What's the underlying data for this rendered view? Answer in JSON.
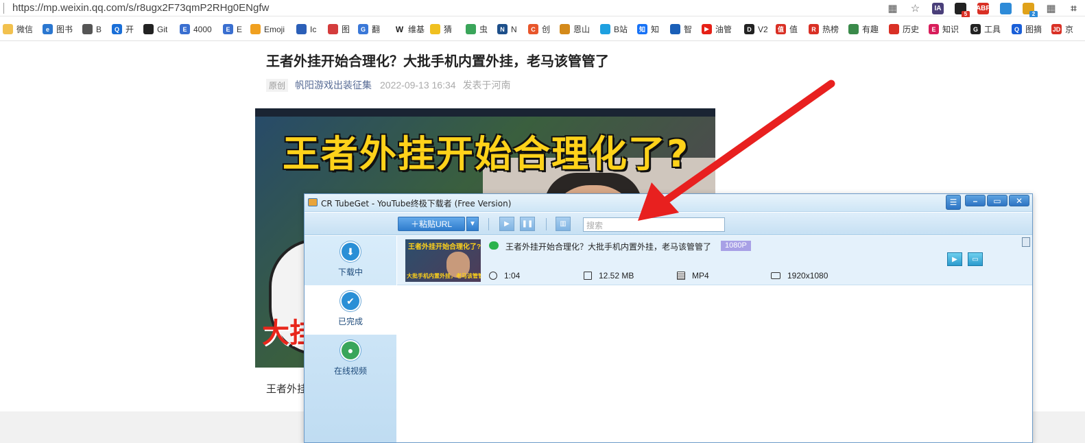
{
  "browser": {
    "url": "https://mp.weixin.qq.com/s/r8ugx2F73qmP2RHg0ENgfw",
    "extensions": [
      {
        "icon": "qr-code-icon",
        "text": "▦",
        "color": "#555555"
      },
      {
        "icon": "star-icon",
        "text": "☆",
        "color": "#555555"
      },
      {
        "icon": "ia-extension-icon",
        "text": "IA",
        "color": "#4a3f7a"
      },
      {
        "icon": "extension-red-icon",
        "text": "",
        "badge": "5",
        "color": "#222222",
        "badge_color": "#d93025"
      },
      {
        "icon": "abp-icon",
        "text": "ABP",
        "color": "#d93025"
      },
      {
        "icon": "color-wheel-icon",
        "text": "",
        "color": "#2e8bd8"
      },
      {
        "icon": "translate-icon",
        "text": "",
        "badge": "2",
        "color": "#e0a21a",
        "badge_color": "#2e8bd8"
      },
      {
        "icon": "grid-icon",
        "text": "▦",
        "color": "#555555"
      },
      {
        "icon": "crop-icon",
        "text": "⌗",
        "color": "#555555"
      }
    ]
  },
  "bookmarks": [
    {
      "label": "微信",
      "icon": "folder-icon",
      "color": "#f2c14e",
      "glyph": ""
    },
    {
      "label": "图书",
      "icon": "ie-icon",
      "color": "#2b77d0",
      "glyph": "e"
    },
    {
      "label": "B",
      "icon": "globe-icon",
      "color": "#555555",
      "glyph": ""
    },
    {
      "label": "开",
      "icon": "qcloud-icon",
      "color": "#1a6fd8",
      "glyph": "Q"
    },
    {
      "label": "Git",
      "icon": "github-icon",
      "color": "#222222",
      "glyph": ""
    },
    {
      "label": "4000",
      "icon": "e-icon",
      "color": "#3a6fd0",
      "glyph": "E"
    },
    {
      "label": "E",
      "icon": "e-icon",
      "color": "#3a6fd0",
      "glyph": "E"
    },
    {
      "label": "Emoji",
      "icon": "emoji-icon",
      "color": "#f0a020",
      "glyph": ""
    },
    {
      "label": "Ic",
      "icon": "flag-icon",
      "color": "#2b5fb8",
      "glyph": ""
    },
    {
      "label": "图",
      "icon": "grid-red-icon",
      "color": "#d43c3c",
      "glyph": ""
    },
    {
      "label": "翻",
      "icon": "translate-icon",
      "color": "#3a78d8",
      "glyph": "G"
    },
    {
      "label": "维基",
      "icon": "wikipedia-icon",
      "color": "#ffffff",
      "glyph": "W"
    },
    {
      "label": "猜",
      "icon": "cloud-icon",
      "color": "#f0c020",
      "glyph": ""
    },
    {
      "label": "虫",
      "icon": "bug-icon",
      "color": "#3aa55a",
      "glyph": ""
    },
    {
      "label": "N",
      "icon": "n-icon",
      "color": "#1d4f8a",
      "glyph": "N"
    },
    {
      "label": "创",
      "icon": "c-icon",
      "color": "#e8562b",
      "glyph": "C"
    },
    {
      "label": "恩山",
      "icon": "router-icon",
      "color": "#d48a1a",
      "glyph": ""
    },
    {
      "label": "B站",
      "icon": "bilibili-icon",
      "color": "#1ea0e0",
      "glyph": ""
    },
    {
      "label": "知",
      "icon": "zhihu-icon",
      "color": "#1772f6",
      "glyph": "知"
    },
    {
      "label": "智",
      "icon": "ring-icon",
      "color": "#1a5fb8",
      "glyph": ""
    },
    {
      "label": "油管",
      "icon": "youtube-icon",
      "color": "#e62117",
      "glyph": "▶"
    },
    {
      "label": "V2",
      "icon": "v2ex-icon",
      "color": "#222222",
      "glyph": "D"
    },
    {
      "label": "值",
      "icon": "smzdm-icon",
      "color": "#d93025",
      "glyph": "值"
    },
    {
      "label": "热榜",
      "icon": "r-icon",
      "color": "#d93025",
      "glyph": "R"
    },
    {
      "label": "有趣",
      "icon": "pill-icon",
      "color": "#3a8a4a",
      "glyph": ""
    },
    {
      "label": "历史",
      "icon": "wave-icon",
      "color": "#d93025",
      "glyph": ""
    },
    {
      "label": "知识",
      "icon": "e-red-icon",
      "color": "#d81e5b",
      "glyph": "E"
    },
    {
      "label": "工具",
      "icon": "g-icon",
      "color": "#222222",
      "glyph": "G"
    },
    {
      "label": "图摘",
      "icon": "search-blue-icon",
      "color": "#1a5fd8",
      "glyph": "Q"
    },
    {
      "label": "京",
      "icon": "jd-icon",
      "color": "#d93025",
      "glyph": "JD"
    }
  ],
  "article": {
    "title": "王者外挂开始合理化？大批手机内置外挂，老马该管管了",
    "original_tag": "原创",
    "author": "帆阳游戏出装征集",
    "date": "2022-09-13 16:34",
    "location": "发表于河南",
    "cover_headline": "王者外挂开始合理化了?",
    "cover_bottom_text": "大挂",
    "body_start": "王者外挂"
  },
  "app": {
    "title": "CR TubeGet - YouTube终极下载者 (Free Version)",
    "window_buttons": {
      "menu": "☰",
      "minimize": "–",
      "maximize": "▭",
      "close": "✕"
    },
    "toolbar": {
      "paste_label": "＋粘贴URL",
      "dropdown": "▼",
      "search_placeholder": "搜索"
    },
    "sidebar": [
      {
        "label": "下载中",
        "icon": "download-icon",
        "glyph": "⬇",
        "color": "#2a8fd6"
      },
      {
        "label": "已完成",
        "icon": "check-icon",
        "glyph": "✔",
        "color": "#2a8fd6"
      },
      {
        "label": "在线视频",
        "icon": "globe-icon",
        "glyph": "●",
        "color": "#3aa55a"
      }
    ],
    "download": {
      "thumb_top": "王者外挂开始合理化了?",
      "thumb_bottom": "大批手机内置外挂，老马该管管了",
      "title": "王者外挂开始合理化？大批手机内置外挂，老马该管管了",
      "resolution_badge": "1080P",
      "duration": "1:04",
      "size": "12.52 MB",
      "format": "MP4",
      "dimensions": "1920x1080",
      "play_glyph": "▶",
      "folder_glyph": "▭"
    }
  }
}
